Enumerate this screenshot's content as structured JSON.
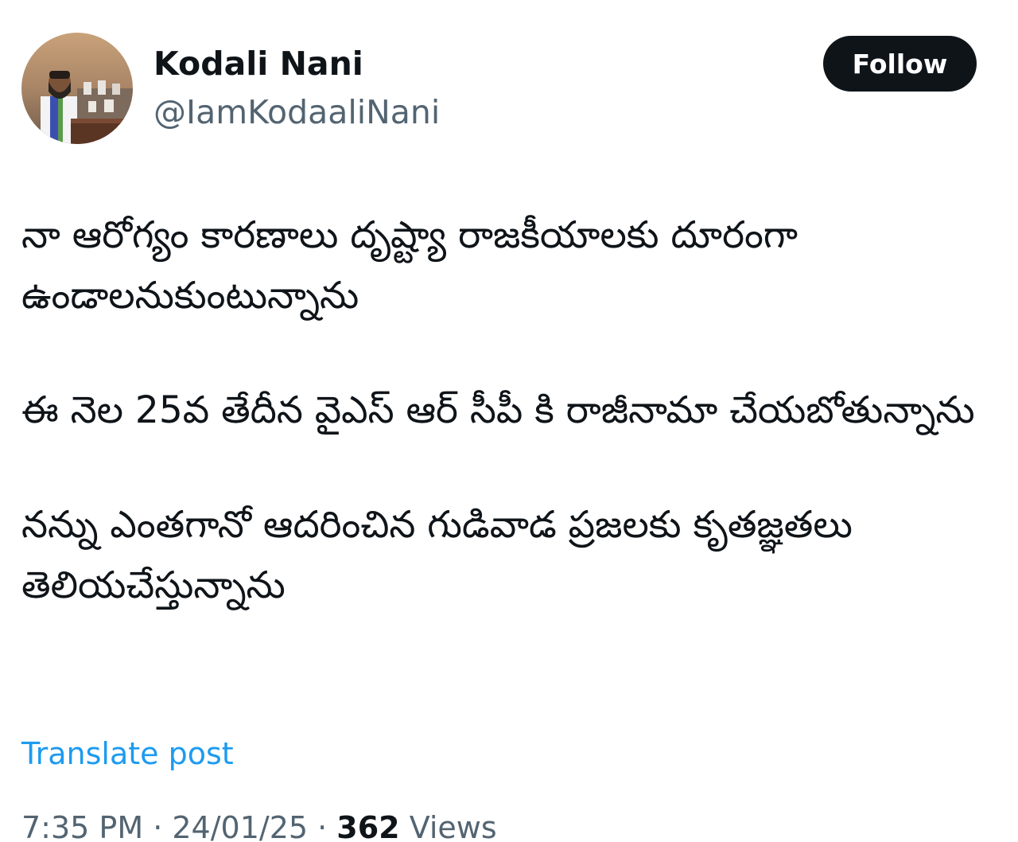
{
  "author": {
    "name": "Kodali Nani",
    "handle": "@IamKodaaliNani"
  },
  "follow_button": {
    "label": "Follow"
  },
  "tweet": {
    "paragraphs": [
      "నా ఆరోగ్యం కారణాలు దృష్ట్యా రాజకీయాలకు దూరంగా ఉండాలనుకుంటున్నాను",
      "ఈ నెల 25వ తేదీన వైఎస్ ఆర్ సీపీ కి రాజీనామా చేయబోతున్నాను",
      "నన్ను ఎంతగానో ఆదరించిన గుడివాడ ప్రజలకు కృతజ్ఞతలు తెలియచేస్తున్నాను"
    ],
    "translate_label": "Translate post"
  },
  "meta": {
    "time": "7:35 PM",
    "separator_1": " · ",
    "date": "24/01/25",
    "separator_2": " · ",
    "views_count": "362",
    "views_label": " Views"
  },
  "icons": {
    "avatar": "profile-photo"
  },
  "colors": {
    "text_primary": "#0f1419",
    "text_secondary": "#536471",
    "link": "#1d9bf0",
    "button_bg": "#0f1419",
    "button_text": "#ffffff",
    "background": "#ffffff"
  }
}
